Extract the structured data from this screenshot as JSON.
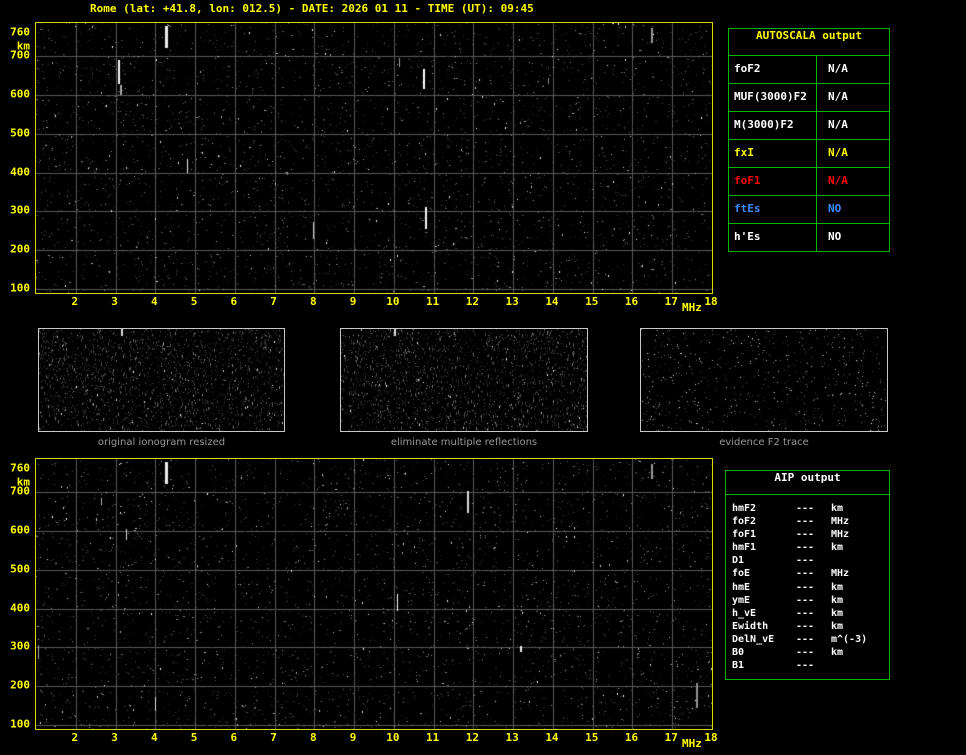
{
  "header": {
    "title": "Rome (lat: +41.8, lon: 012.5) - DATE: 2026 01 11 - TIME (UT): 09:45"
  },
  "ionogram_axes": {
    "y_unit": "km",
    "y_ticks": [
      "760",
      "700",
      "600",
      "500",
      "400",
      "300",
      "200",
      "100"
    ],
    "x_unit": "MHz",
    "x_ticks": [
      "2",
      "3",
      "4",
      "5",
      "6",
      "7",
      "8",
      "9",
      "10",
      "11",
      "12",
      "13",
      "14",
      "15",
      "16",
      "17",
      "18"
    ]
  },
  "autoscala_table": {
    "title": "AUTOSCALA output",
    "rows": [
      {
        "label": "foF2",
        "value": "N/A",
        "color": "#ffffff"
      },
      {
        "label": "MUF(3000)F2",
        "value": "N/A",
        "color": "#ffffff"
      },
      {
        "label": "M(3000)F2",
        "value": "N/A",
        "color": "#ffffff"
      },
      {
        "label": "fxI",
        "value": "N/A",
        "color": "#ffff00"
      },
      {
        "label": "foF1",
        "value": "N/A",
        "color": "#ff0000"
      },
      {
        "label": "ftEs",
        "value": "NO",
        "color": "#3c8cff"
      },
      {
        "label": "h'Es",
        "value": "NO",
        "color": "#ffffff"
      }
    ]
  },
  "thumbnails": {
    "captions": [
      "original ionogram resized",
      "eliminate multiple reflections",
      "evidence F2 trace"
    ]
  },
  "aip_table": {
    "title": "AIP output",
    "rows": [
      {
        "label": "hmF2",
        "value": "---",
        "unit": "km"
      },
      {
        "label": "foF2",
        "value": "---",
        "unit": "MHz"
      },
      {
        "label": "foF1",
        "value": "---",
        "unit": "MHz"
      },
      {
        "label": "hmF1",
        "value": "---",
        "unit": "km"
      },
      {
        "label": "D1",
        "value": "---",
        "unit": ""
      },
      {
        "label": "foE",
        "value": "---",
        "unit": "MHz"
      },
      {
        "label": "hmE",
        "value": "---",
        "unit": "km"
      },
      {
        "label": "ymE",
        "value": "---",
        "unit": "km"
      },
      {
        "label": "h_vE",
        "value": "---",
        "unit": "km"
      },
      {
        "label": "Ewidth",
        "value": "---",
        "unit": "km"
      },
      {
        "label": "DelN_vE",
        "value": "---",
        "unit": "m^(-3)"
      },
      {
        "label": "B0",
        "value": "---",
        "unit": "km"
      },
      {
        "label": "B1",
        "value": "---",
        "unit": ""
      }
    ]
  },
  "palette": {
    "background": "#000000",
    "axis_text": "#ffff00",
    "plot_border": "#d9d900",
    "grid": "#5a5a5a",
    "table_border": "#00b400",
    "caption_text": "#989898"
  }
}
